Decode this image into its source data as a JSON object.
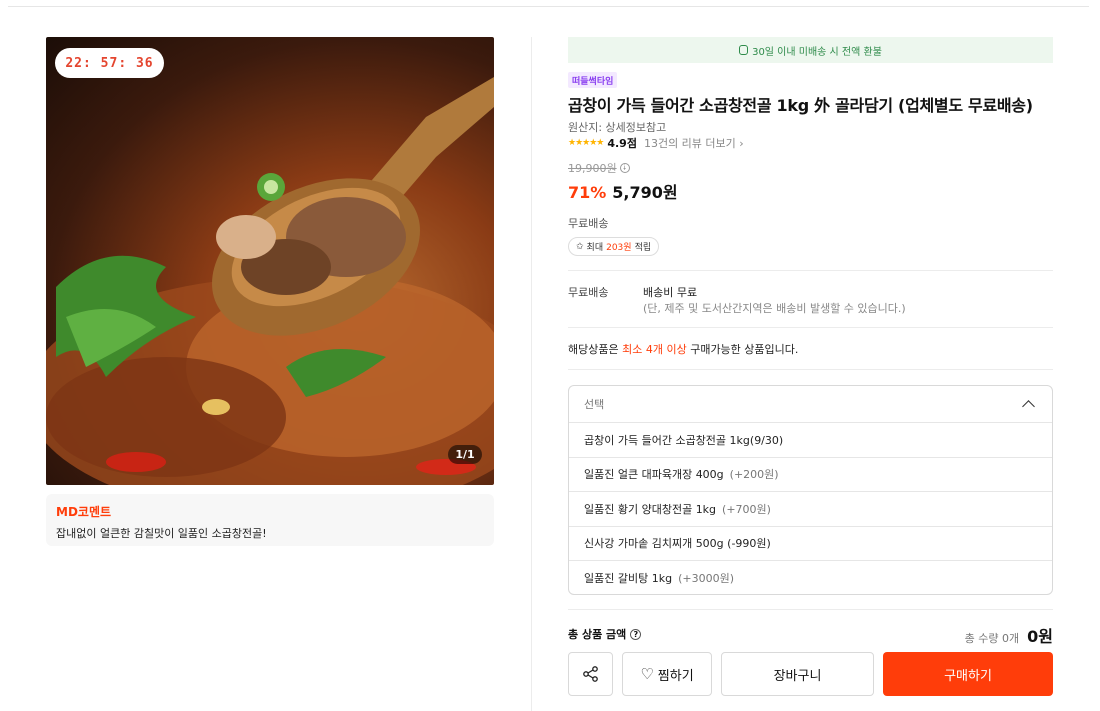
{
  "timer": "22:  57:  36",
  "image_counter": "1/1",
  "md": {
    "title": "MD코멘트",
    "text": "잡내없이 얼큰한 감칠맛이 일품인 소곱창전골!"
  },
  "refund_notice": "30일 이내 미배송 시 전액 환불",
  "badge": "떠들썩타임",
  "product_title": "곱창이 가득 들어간 소곱창전골 1kg 外 골라담기 (업체별도 무료배송)",
  "origin": "원산지: 상세정보참고",
  "rating": {
    "stars": "★★★★★",
    "score": "4.9점",
    "reviews": "13건의 리뷰 더보기 ›"
  },
  "original_price": "19,900원",
  "discount": "71%",
  "price": "5,790원",
  "shipping_label": "무료배송",
  "points": {
    "prefix": "최대 ",
    "amount": "203원",
    "suffix": " 적립"
  },
  "shipping": {
    "key": "무료배송",
    "value": "배송비 무료",
    "note": "(단, 제주 및 도서산간지역은 배송비 발생할 수 있습니다.)"
  },
  "min_order": {
    "prefix": "해당상품은 ",
    "highlight": "최소 4개 이상",
    "suffix": " 구매가능한 상품입니다."
  },
  "select": {
    "placeholder": "선택",
    "options": [
      {
        "name": "곱창이 가득 들어간 소곱창전골 1kg(9/30)",
        "extra": ""
      },
      {
        "name": "일품진 얼큰 대파육개장 400g",
        "extra": "(+200원)"
      },
      {
        "name": "일품진 황기 양대창전골 1kg",
        "extra": "(+700원)"
      },
      {
        "name": "신사강 가마솥 김치찌개 500g (-990원)",
        "extra": ""
      },
      {
        "name": "일품진 갈비탕 1kg",
        "extra": "(+3000원)"
      }
    ]
  },
  "total": {
    "label": "총 상품 금액",
    "help": "?",
    "qty": "총 수량 0개",
    "amount": "0원"
  },
  "buttons": {
    "wish": "찜하기",
    "cart": "장바구니",
    "buy": "구매하기"
  },
  "colors": {
    "accent": "#ff3d0a",
    "refund_bg": "#edf7ee",
    "badge": "#8a3ff0"
  }
}
